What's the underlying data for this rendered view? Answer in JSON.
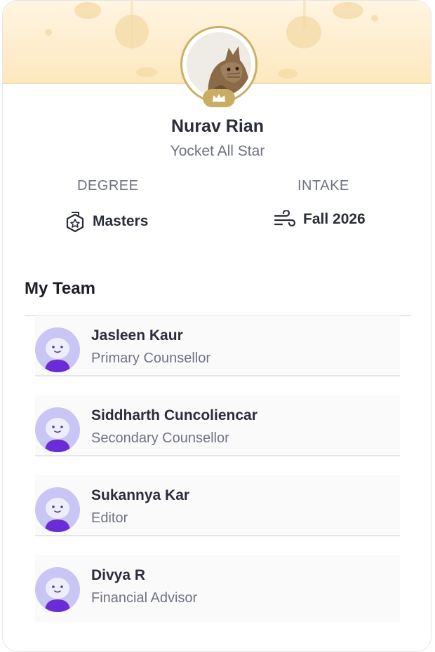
{
  "profile": {
    "name": "Nurav Rian",
    "subtitle": "Yocket All Star",
    "crown_icon": "crown-icon",
    "photo_icon": "cat-photo"
  },
  "stats": {
    "degree": {
      "label": "DEGREE",
      "value": "Masters",
      "icon": "badge-icon"
    },
    "intake": {
      "label": "INTAKE",
      "value": "Fall 2026",
      "icon": "wind-icon"
    }
  },
  "team": {
    "title": "My Team",
    "members": [
      {
        "name": "Jasleen Kaur",
        "role": "Primary Counsellor"
      },
      {
        "name": "Siddharth Cuncoliencar",
        "role": "Secondary Counsellor"
      },
      {
        "name": "Sukannya Kar",
        "role": "Editor"
      },
      {
        "name": "Divya R",
        "role": "Financial Advisor"
      }
    ]
  },
  "colors": {
    "banner": "#fde8bf",
    "gold": "#c9ad62",
    "avatar_bg": "#c9c5f5",
    "avatar_body": "#6a2bd8"
  }
}
